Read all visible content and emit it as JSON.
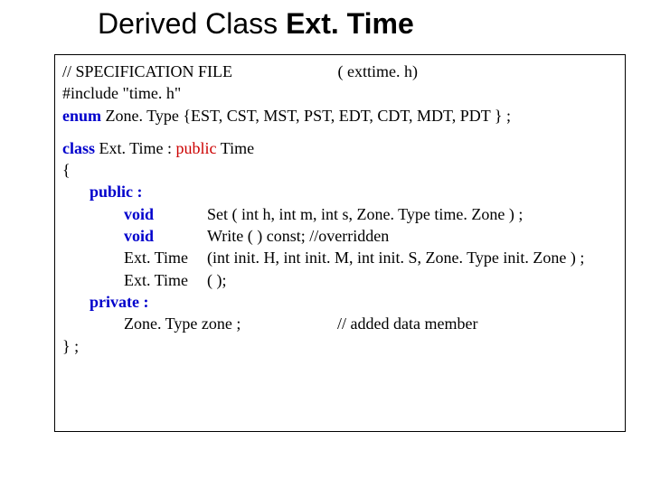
{
  "title": {
    "prefix": "Derived Class ",
    "bold": "Ext. Time"
  },
  "code": {
    "l1a": "// SPECIFICATION   FILE",
    "l1b": "( exttime. h)",
    "l2": "#include   \"time. h\"",
    "l3a": "enum",
    "l3b": "  Zone. Type {EST, CST, MST, PST, EDT, CDT, MDT, PDT } ;",
    "l4a": "class",
    "l4b": "  Ext. Time  :  ",
    "l4c": "public",
    "l4d": "  Time",
    "l5": "{",
    "l6": "public :",
    "l7a": "void",
    "l7b": "Set ( int h, int m, int s, Zone. Type time. Zone ) ;",
    "l8a": "void",
    "l8b": "Write ( )  const;     //overridden",
    "l9a": "Ext. Time",
    "l9b": "(int init. H, int init. M, int init. S, Zone. Type init. Zone ) ;",
    "l10a": "Ext. Time",
    "l10b": "( );",
    "l11": "private :",
    "l12a": "Zone. Type  zone ;",
    "l12b": "// added data member",
    "l13": "} ;"
  }
}
